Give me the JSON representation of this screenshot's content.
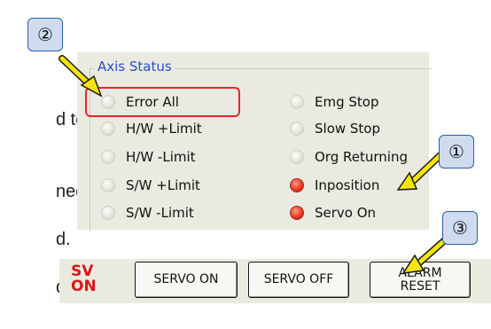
{
  "background_fragments": [
    "d to",
    "ned,",
    "d.",
    "ding"
  ],
  "status": {
    "group_title": "Axis Status",
    "left_column": [
      {
        "label": "Error All",
        "state": "off"
      },
      {
        "label": "H/W +Limit",
        "state": "off"
      },
      {
        "label": "H/W -Limit",
        "state": "off"
      },
      {
        "label": "S/W +Limit",
        "state": "off"
      },
      {
        "label": "S/W -Limit",
        "state": "off"
      }
    ],
    "right_column": [
      {
        "label": "Emg Stop",
        "state": "off"
      },
      {
        "label": "Slow Stop",
        "state": "off"
      },
      {
        "label": "Org Returning",
        "state": "off"
      },
      {
        "label": "Inposition",
        "state": "on"
      },
      {
        "label": "Servo On",
        "state": "on"
      }
    ]
  },
  "callouts": {
    "one": "①",
    "two": "②",
    "three": "③"
  },
  "controls": {
    "logo_line1": "SV",
    "logo_line2": "ON",
    "servo_on": "SERVO ON",
    "servo_off": "SERVO OFF",
    "alarm_reset_line1": "ALARM",
    "alarm_reset_line2": "RESET"
  },
  "colors": {
    "led_on": "#ea3a24",
    "highlight": "#e8242a",
    "arrow": "#f5e40c",
    "title_blue": "#2250c8"
  }
}
